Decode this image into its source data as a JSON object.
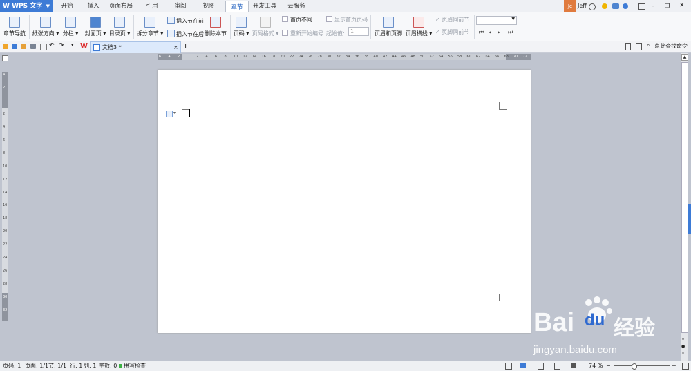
{
  "app": {
    "name": "WPS 文字"
  },
  "menu": {
    "tabs": [
      "开始",
      "插入",
      "页面布局",
      "引用",
      "审阅",
      "视图",
      "章节",
      "开发工具",
      "云服务"
    ],
    "active_tab": "章节"
  },
  "user": {
    "avatar_text": "Je",
    "name": "Jeff"
  },
  "ribbon": {
    "chapter_nav": "章节导航",
    "paper_orientation": "纸张方向",
    "columns": "分栏",
    "cover_page": "封面页",
    "toc_page": "目录页",
    "split_chapter": "拆分章节",
    "insert_section_before": "插入节在前",
    "insert_section_after": "插入节在后",
    "delete_section": "删除本节",
    "page_number": "页码",
    "page_number_format": "页码格式",
    "first_page_different": "首页不同",
    "restart_numbering": "重新开始编号",
    "show_first_page_number": "显示首页页码",
    "start_value_label": "起始值:",
    "start_value": "1",
    "header_footer": "页眉和页脚",
    "header_line": "页眉横线",
    "same_as_prev_header": "页眉同前节",
    "same_as_prev_footer": "页脚同前节"
  },
  "tabbar": {
    "doc_title": "文档3 *",
    "search_placeholder": "点此查找命令"
  },
  "ruler": {
    "h_ticks": [
      "6",
      "4",
      "2",
      "",
      "2",
      "4",
      "6",
      "8",
      "10",
      "12",
      "14",
      "16",
      "18",
      "20",
      "22",
      "24",
      "26",
      "28",
      "30",
      "32",
      "34",
      "36",
      "38",
      "40",
      "42",
      "44",
      "46",
      "48",
      "50",
      "52",
      "54",
      "56",
      "58",
      "60",
      "62",
      "64",
      "66",
      "68",
      "70",
      "72"
    ],
    "v_ticks": [
      "4",
      "2",
      "",
      "2",
      "4",
      "6",
      "8",
      "10",
      "12",
      "14",
      "16",
      "18",
      "20",
      "22",
      "24",
      "26",
      "28",
      "30",
      "32"
    ]
  },
  "status": {
    "page": "页码: 1",
    "pages": "页面: 1/1",
    "section": "节: 1/1",
    "row": "行: 1",
    "col": "列: 1",
    "words": "字数: 0",
    "spell": "拼写检查",
    "zoom": "74 %"
  },
  "watermark": {
    "brand": "Bai",
    "brand2": "du",
    "cn": "经验",
    "url": "jingyan.baidu.com"
  },
  "colors": {
    "accent": "#3d7bd6",
    "user_bg": "#e07b3f"
  }
}
